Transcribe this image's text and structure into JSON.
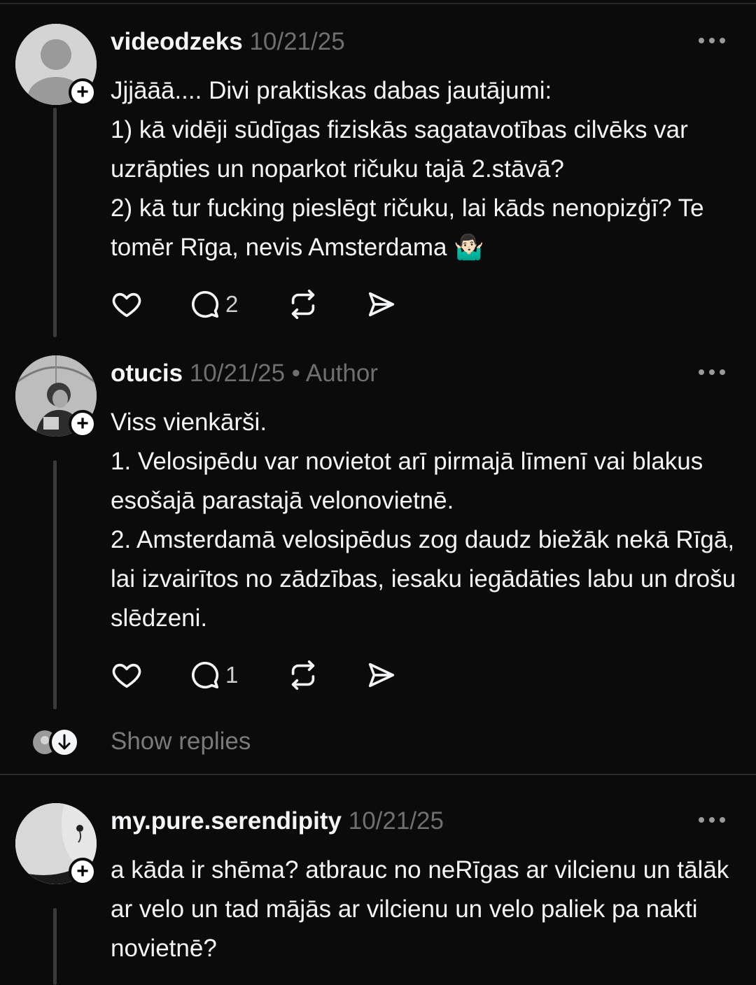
{
  "posts": [
    {
      "username": "videodzeks",
      "date": "10/21/25",
      "tag": "",
      "text": "Jjjāāā.... Divi praktiskas dabas  jautājumi:\n1) kā vidēji sūdīgas fiziskās sagatavotības cilvēks var uzrāpties un noparkot ričuku tajā 2.stāvā?\n2) kā tur fucking pieslēgt ričuku, lai kāds nenopizģī? Te tomēr Rīga, nevis Amsterdama 🤷🏻‍♂️",
      "replies": "2",
      "avatar_icon": "default-person-avatar"
    },
    {
      "username": "otucis",
      "date": "10/21/25",
      "tag": "• Author",
      "text": "Viss vienkārši.\n1. Velosipēdu var novietot arī pirmajā līmenī vai blakus esošajā parastajā velonovietnē.\n2. Amsterdamā velosipēdus zog daudz biežāk nekā Rīgā, lai izvairītos no zādzības, iesaku iegādāties labu un drošu slēdzeni.",
      "replies": "1",
      "avatar_icon": "photo-avatar-person-umbrella"
    },
    {
      "username": "my.pure.serendipity",
      "date": "10/21/25",
      "tag": "",
      "text": "a kāda ir shēma? atbrauc no neRīgas ar vilcienu un tālāk ar velo un tad mājās ar vilcienu un velo paliek pa nakti novietnē?",
      "replies": "",
      "avatar_icon": "photo-avatar-neck-earring"
    }
  ],
  "show_replies_label": "Show replies",
  "colors": {
    "background": "#0b0b0b",
    "text": "#f3f5f7",
    "muted": "#6f6f6f",
    "thread_line": "#3a3a3a"
  }
}
